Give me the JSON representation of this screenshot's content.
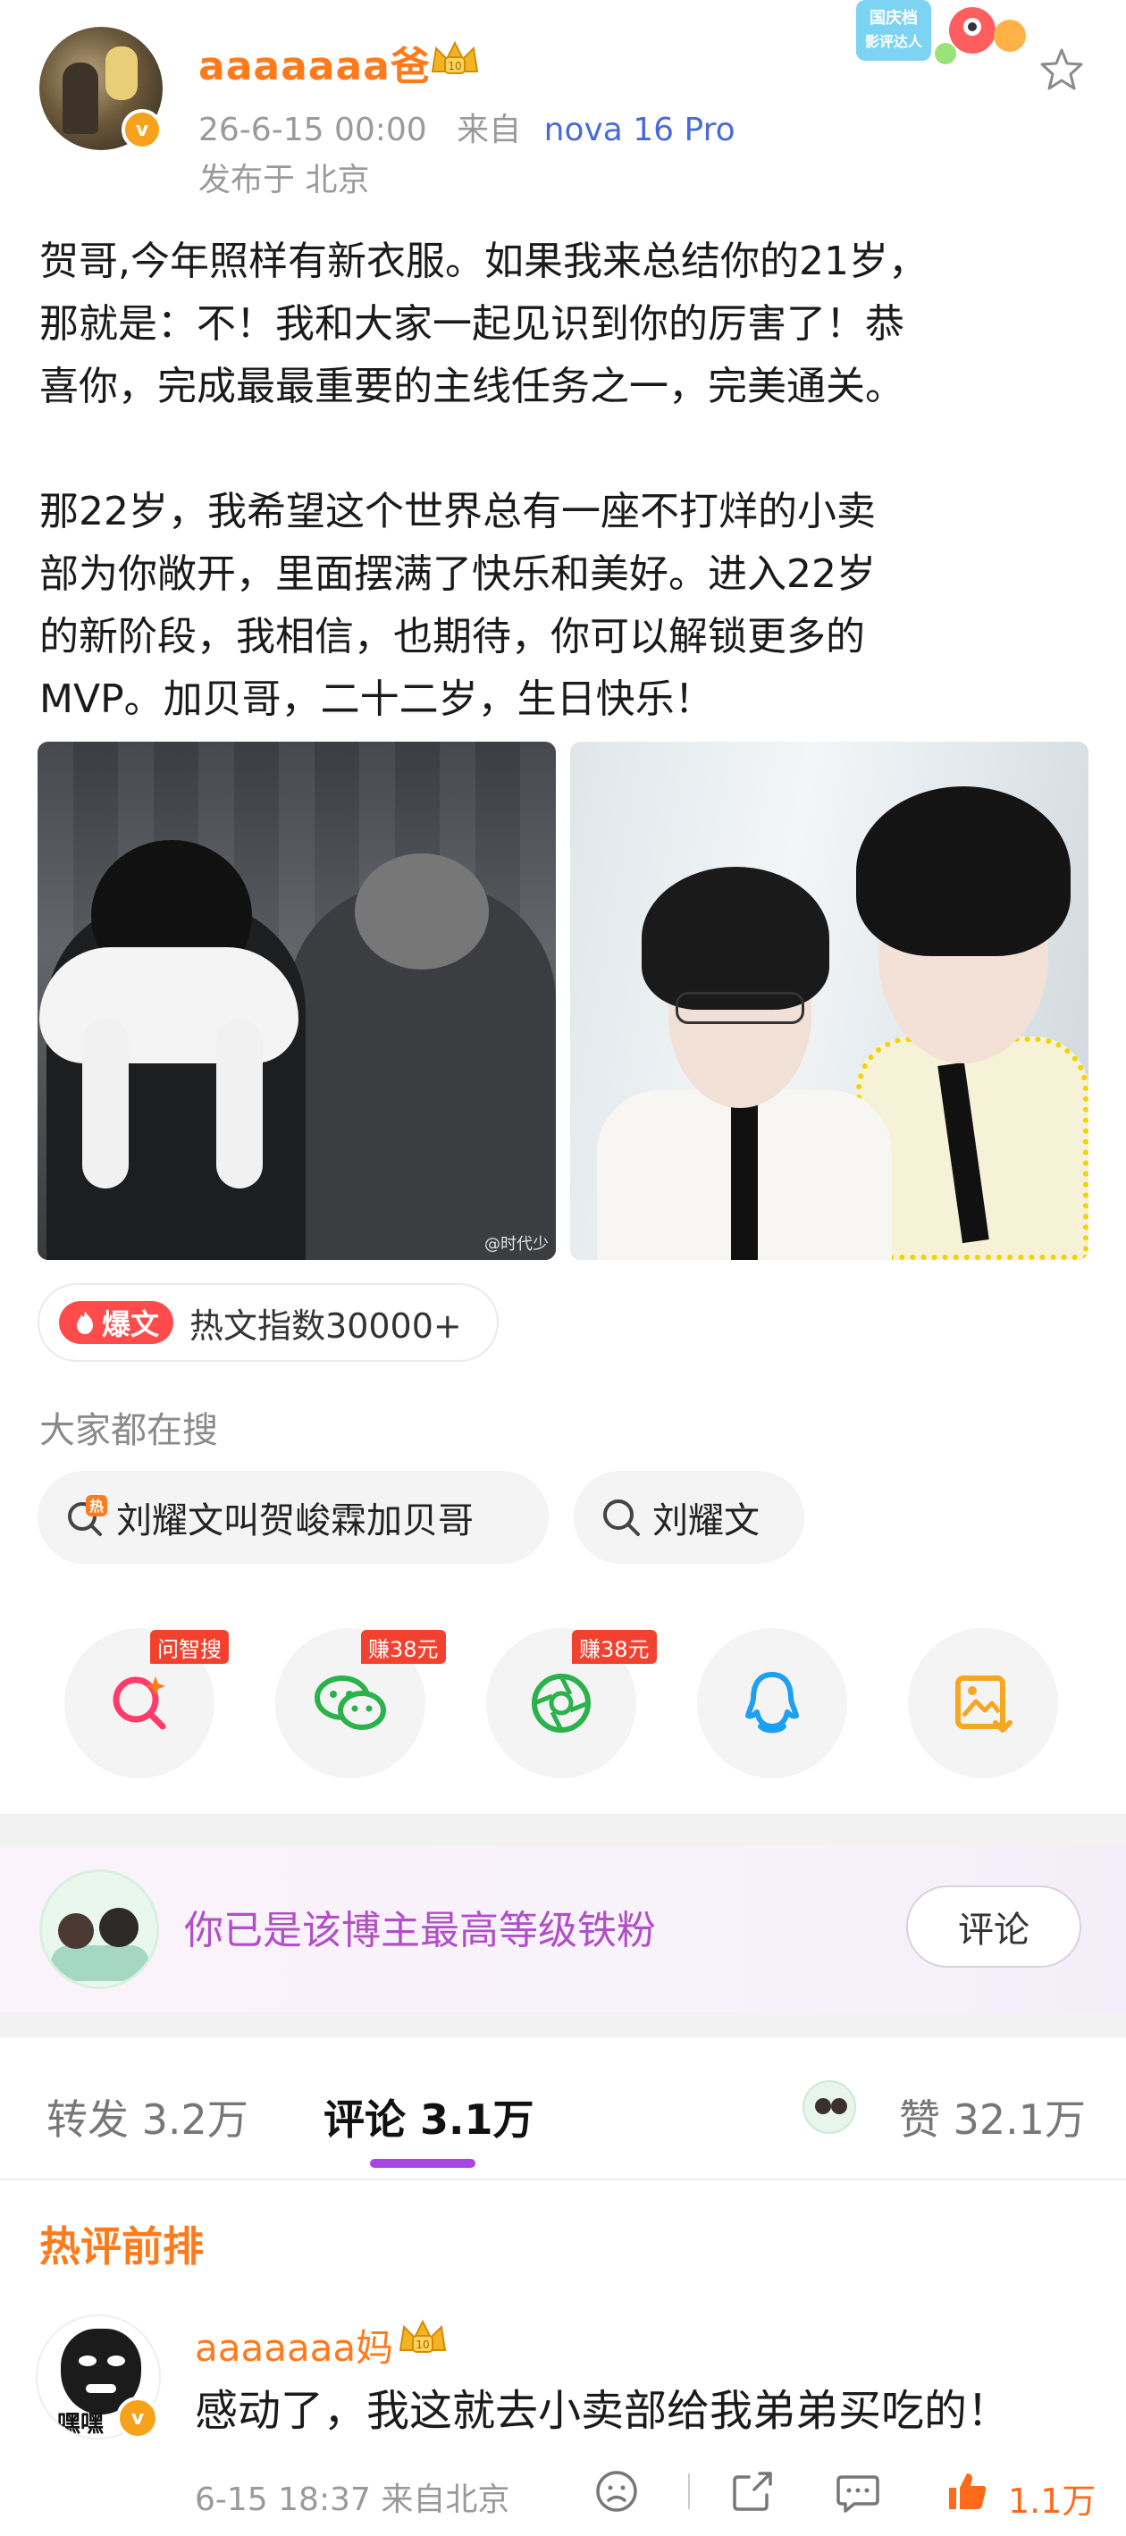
{
  "post": {
    "author": "aaaaaaa爸",
    "verified_mark": "v",
    "time": "26-6-15 00:00",
    "source_prefix": "来自",
    "device": "nova 16 Pro",
    "location": "发布于 北京",
    "promo_badge_text": "国庆档 影评达人",
    "text": "贺哥,今年照样有新衣服。如果我来总结你的21岁，\n那就是：不！我和大家一起见识到你的厉害了！恭\n喜你，完成最最重要的主线任务之一，完美通关。\n\n那22岁，我希望这个世界总有一座不打烊的小卖\n部为你敞开，里面摆满了快乐和美好。进入22岁\n的新阶段，我相信，也期待，你可以解锁更多的\nMVP。加贝哥，二十二岁，生日快乐！",
    "photo_watermark": "@时代少"
  },
  "hot": {
    "tag": "爆文",
    "text": "热文指数30000+"
  },
  "search": {
    "heading": "大家都在搜",
    "chips": [
      {
        "label": "刘耀文叫贺峻霖加贝哥",
        "icon_tag": "热"
      },
      {
        "label": "刘耀文"
      }
    ]
  },
  "share": {
    "items": [
      {
        "icon": "ai-search-icon",
        "tag": "问智搜",
        "color": "#ff3b6b"
      },
      {
        "icon": "wechat-icon",
        "tag": "赚38元",
        "color": "#2bb24c"
      },
      {
        "icon": "moments-icon",
        "tag": "赚38元",
        "color": "#2bb24c"
      },
      {
        "icon": "qq-icon",
        "tag": "",
        "color": "#1ea0f2"
      },
      {
        "icon": "save-image-icon",
        "tag": "",
        "color": "#f5a623"
      }
    ]
  },
  "fan": {
    "text": "你已是该博主最高等级铁粉",
    "button": "评论"
  },
  "tabs": {
    "repost": "转发 3.2万",
    "comment": "评论 3.1万",
    "like": "赞 32.1万"
  },
  "comments": {
    "heading": "热评前排",
    "items": [
      {
        "author": "aaaaaaa妈",
        "avatar_text": "嘿嘿",
        "verified_mark": "v",
        "text": "感动了，我这就去小卖部给我弟弟买吃的！",
        "meta": "6-15 18:37 来自北京",
        "likes": "1.1万"
      }
    ]
  },
  "colors": {
    "accent_orange": "#ff7a1a",
    "fan_purple": "#b24fc7",
    "tab_underline": "#a844e6",
    "hot_red": "#ff4b4b"
  }
}
